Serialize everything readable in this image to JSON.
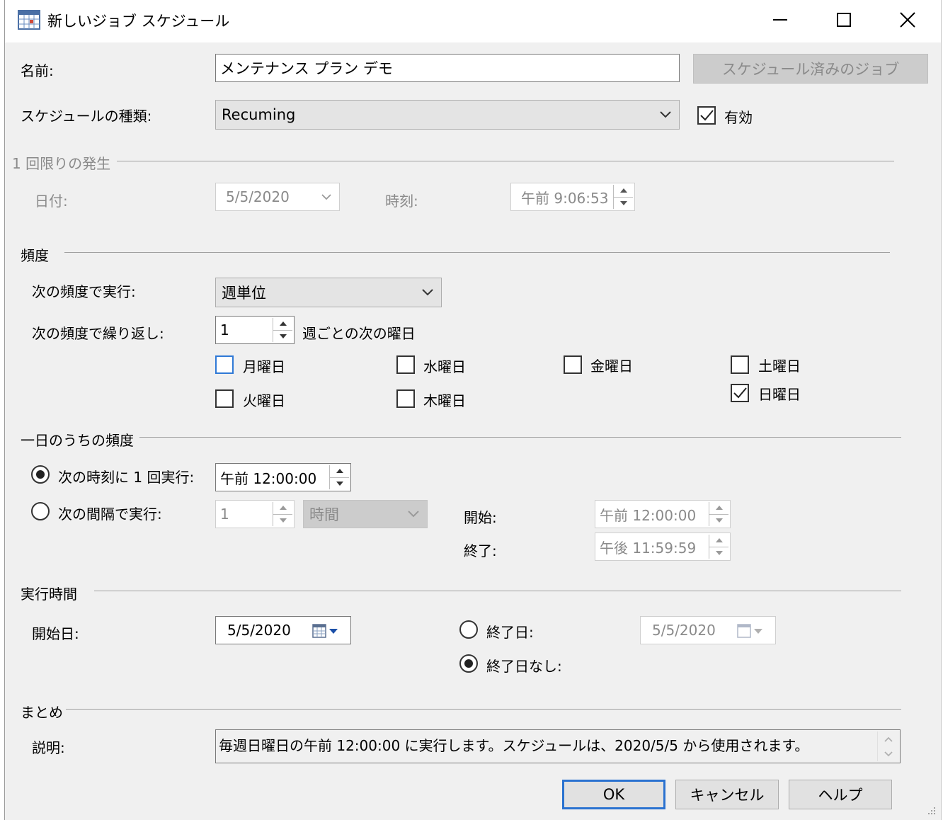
{
  "window": {
    "title": "新しいジョブ スケジュール"
  },
  "name": {
    "label": "名前:",
    "value": "メンテナンス プラン デモ"
  },
  "scheduled_jobs_button": "スケジュール済みのジョブ",
  "schedule_type": {
    "label": "スケジュールの種類:",
    "value": "Recuming"
  },
  "enabled": {
    "label": "有効",
    "checked": true
  },
  "one_time": {
    "group": "1 回限りの発生",
    "date_label": "日付:",
    "date_value": "5/5/2020",
    "time_label": "時刻:",
    "time_value": "午前 9:06:53"
  },
  "frequency": {
    "group": "頻度",
    "occurs_label": "次の頻度で実行:",
    "occurs_value": "週単位",
    "recurs_label": "次の頻度で繰り返し:",
    "recurs_value": "1",
    "recurs_suffix": "週ごとの次の曜日",
    "days": {
      "mon": {
        "label": "月曜日",
        "checked": false
      },
      "tue": {
        "label": "火曜日",
        "checked": false
      },
      "wed": {
        "label": "水曜日",
        "checked": false
      },
      "thu": {
        "label": "木曜日",
        "checked": false
      },
      "fri": {
        "label": "金曜日",
        "checked": false
      },
      "sat": {
        "label": "土曜日",
        "checked": false
      },
      "sun": {
        "label": "日曜日",
        "checked": true
      }
    }
  },
  "daily": {
    "group": "一日のうちの頻度",
    "once_label": "次の時刻に 1 回実行:",
    "once_value": "午前 12:00:00",
    "every_label": "次の間隔で実行:",
    "every_value": "1",
    "every_unit": "時間",
    "start_label": "開始:",
    "start_value": "午前 12:00:00",
    "end_label": "終了:",
    "end_value": "午後 11:59:59"
  },
  "duration": {
    "group": "実行時間",
    "start_label": "開始日:",
    "start_value": "5/5/2020",
    "end_date_label": "終了日:",
    "end_date_value": "5/5/2020",
    "no_end_label": "終了日なし:"
  },
  "summary": {
    "group": "まとめ",
    "desc_label": "説明:",
    "desc_value": "毎週日曜日の午前 12:00:00 に実行します。スケジュールは、2020/5/5 から使用されます。"
  },
  "buttons": {
    "ok": "OK",
    "cancel": "キャンセル",
    "help": "ヘルプ"
  }
}
